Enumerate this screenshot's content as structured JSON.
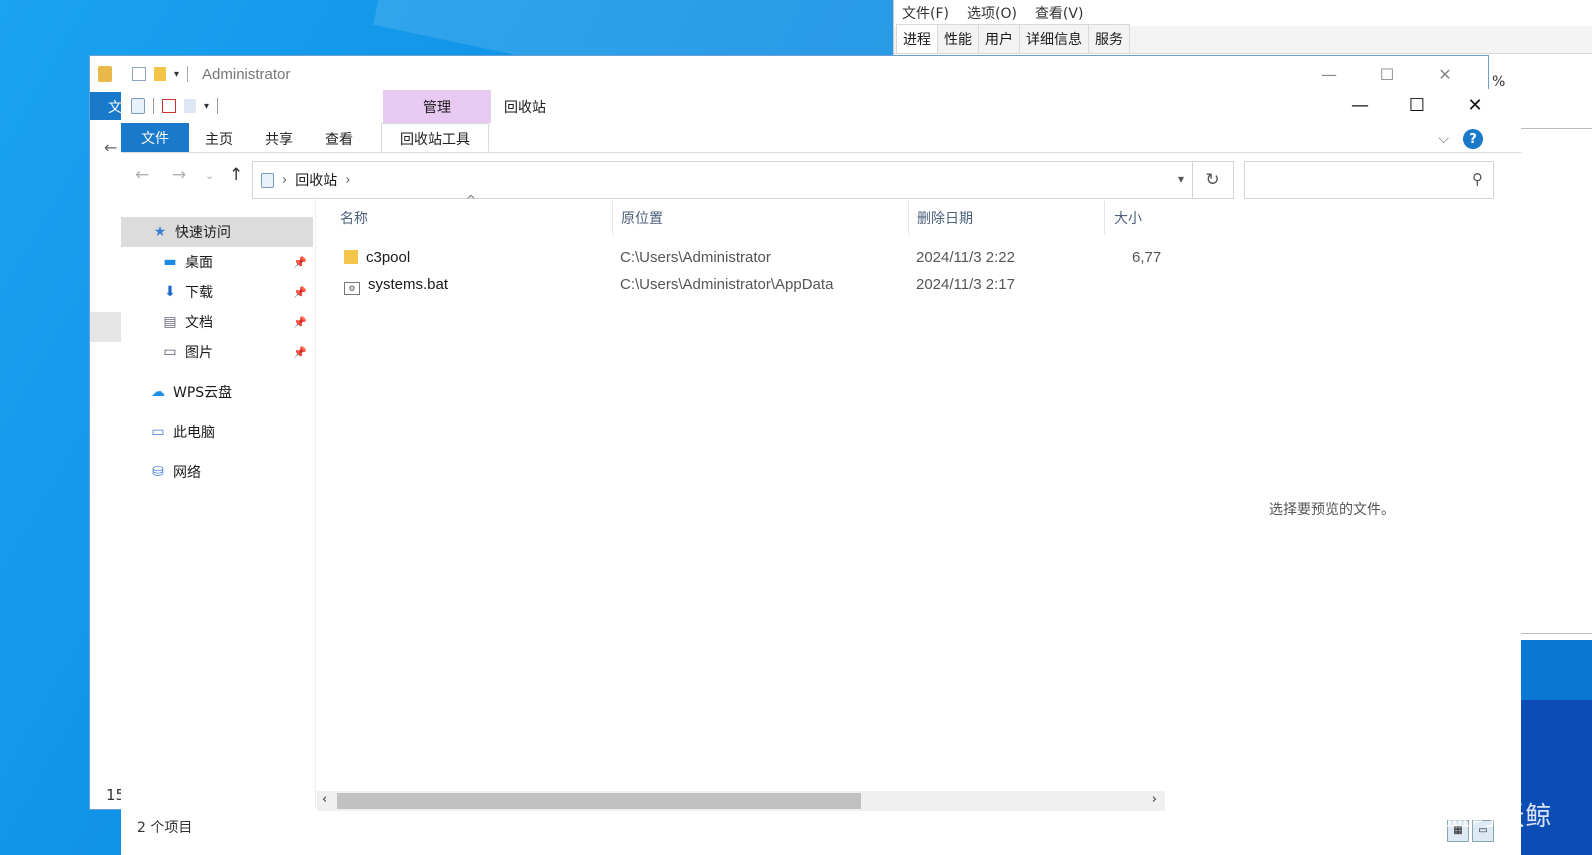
{
  "taskmgr": {
    "menu": [
      "文件(F)",
      "选项(O)",
      "查看(V)"
    ],
    "tabs": [
      "进程",
      "性能",
      "用户",
      "详细信息",
      "服务"
    ],
    "topright_text": "%"
  },
  "outer_window": {
    "title": "Administrator",
    "left_tab_stub": "文",
    "back_arrow": "←",
    "bottom_text": "15"
  },
  "window": {
    "context_group": "管理",
    "title": "回收站",
    "tabs": {
      "file": "文件",
      "home": "主页",
      "share": "共享",
      "view": "查看",
      "context_tools": "回收站工具"
    },
    "help": "?"
  },
  "address": {
    "crumbs": [
      "回收站"
    ]
  },
  "sidebar": {
    "quick_access": "快速访问",
    "items": [
      {
        "label": "桌面",
        "icon": "desktop-icon",
        "pinned": true
      },
      {
        "label": "下载",
        "icon": "download-icon",
        "pinned": true
      },
      {
        "label": "文档",
        "icon": "document-icon",
        "pinned": true
      },
      {
        "label": "图片",
        "icon": "picture-icon",
        "pinned": true
      }
    ],
    "wps": "WPS云盘",
    "this_pc": "此电脑",
    "network": "网络"
  },
  "columns": {
    "name": "名称",
    "location": "原位置",
    "deleted": "删除日期",
    "size": "大小"
  },
  "files": [
    {
      "name": "c3pool",
      "type": "folder",
      "location": "C:\\Users\\Administrator",
      "deleted": "2024/11/3 2:22",
      "size": "6,77"
    },
    {
      "name": "systems.bat",
      "type": "bat",
      "location": "C:\\Users\\Administrator\\AppData",
      "deleted": "2024/11/3 2:17",
      "size": ""
    }
  ],
  "preview_text": "选择要预览的文件。",
  "status": "2 个项目",
  "watermark": "CSDN @海蓝时跃鲸"
}
